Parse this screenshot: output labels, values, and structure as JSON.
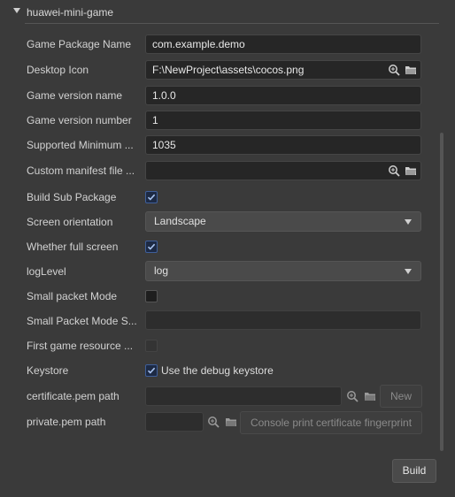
{
  "section": {
    "title": "huawei-mini-game"
  },
  "fields": {
    "package_name": {
      "label": "Game Package Name",
      "value": "com.example.demo"
    },
    "desktop_icon": {
      "label": "Desktop Icon",
      "value": "F:\\NewProject\\assets\\cocos.png"
    },
    "version_name": {
      "label": "Game version name",
      "value": "1.0.0"
    },
    "version_number": {
      "label": "Game version number",
      "value": "1"
    },
    "min_platform": {
      "label": "Supported Minimum ...",
      "value": "1035"
    },
    "manifest": {
      "label": "Custom manifest file ...",
      "value": ""
    },
    "build_sub": {
      "label": "Build Sub Package",
      "checked": true
    },
    "orientation": {
      "label": "Screen orientation",
      "value": "Landscape"
    },
    "full_screen": {
      "label": "Whether full screen",
      "checked": true
    },
    "log_level": {
      "label": "logLevel",
      "value": "log"
    },
    "small_packet": {
      "label": "Small packet Mode",
      "checked": false
    },
    "small_packet_s": {
      "label": "Small Packet Mode S...",
      "value": ""
    },
    "first_res": {
      "label": "First game resource ...",
      "checked": false
    },
    "keystore": {
      "label": "Keystore",
      "option": "Use the debug keystore",
      "checked": true
    },
    "cert_path": {
      "label": "certificate.pem path",
      "value": "",
      "new_label": "New"
    },
    "private_path": {
      "label": "private.pem path",
      "value": "",
      "print_label": "Console print certificate fingerprint"
    }
  },
  "actions": {
    "build_label": "Build"
  },
  "colors": {
    "accent": "#3f5f9a",
    "background": "#3a3a3a"
  }
}
